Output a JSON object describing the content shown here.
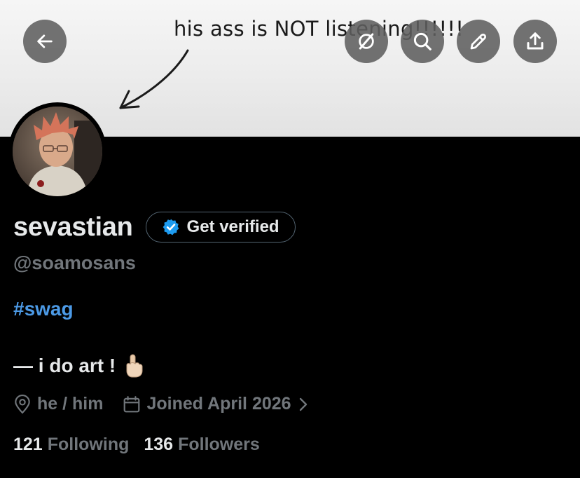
{
  "banner": {
    "caption": "his ass is NOT listening!!!!!!"
  },
  "toolbar": {
    "back_icon": "arrow-left-icon",
    "grok_icon": "grok-icon",
    "search_icon": "search-icon",
    "edit_icon": "pencil-icon",
    "share_icon": "share-icon"
  },
  "profile": {
    "display_name": "sevastian",
    "verify_label": "Get verified",
    "handle": "@soamosans",
    "hashtag": "#swag",
    "bio": "— i do art !",
    "bio_emoji": "☝🏻",
    "pronouns": "he / him",
    "joined": "Joined April 2026",
    "following_count": "121",
    "following_label": "Following",
    "followers_count": "136",
    "followers_label": "Followers"
  },
  "colors": {
    "background": "#000000",
    "text_primary": "#e7e9ea",
    "text_secondary": "#71767b",
    "link_blue": "#4c9ae6",
    "verified_blue": "#1d9bf0"
  }
}
